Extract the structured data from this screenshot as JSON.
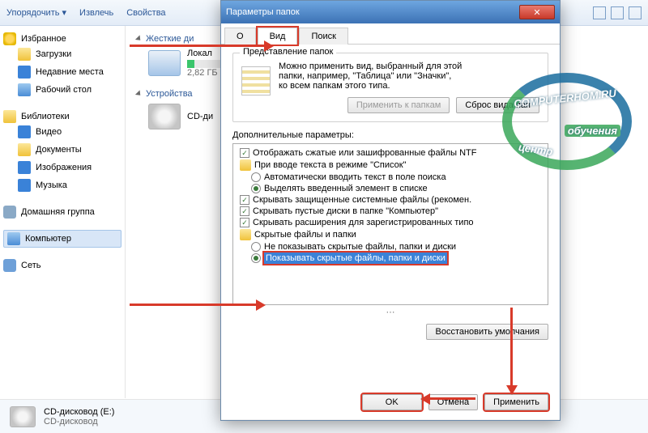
{
  "toolbar": {
    "organize": "Упорядочить ▾",
    "extract": "Извлечь",
    "props": "Свойства"
  },
  "sidebar": {
    "fav": "Избранное",
    "fav_items": [
      "Загрузки",
      "Недавние места",
      "Рабочий стол"
    ],
    "lib": "Библиотеки",
    "lib_items": [
      "Видео",
      "Документы",
      "Изображения",
      "Музыка"
    ],
    "hg": "Домашняя группа",
    "comp": "Компьютер",
    "net": "Сеть"
  },
  "content": {
    "hdd_section": "Жесткие ди",
    "local_disk": "Локал",
    "local_size": "2,82 ГБ",
    "dev_section": "Устройства",
    "cd_label": "CD-ди"
  },
  "footer": {
    "cd_title": "CD-дисковод (E:)",
    "cd_sub": "CD-дисковод"
  },
  "dialog": {
    "title": "Параметры папок",
    "tabs": {
      "general": "О",
      "view": "Вид",
      "search": "Поиск"
    },
    "group_title": "Представление папок",
    "group_text1": "Можно применить вид, выбранный для этой",
    "group_text2": "папки, например, \"Таблица\" или \"Значки\",",
    "group_text3": "ко всем папкам этого типа.",
    "apply_folders": "Применить к папкам",
    "reset_folders": "Сброс вида пап",
    "adv_label": "Дополнительные параметры:",
    "items": [
      {
        "t": "cb",
        "on": true,
        "txt": "Отображать сжатые или зашифрованные файлы NTF",
        "ind": 0
      },
      {
        "t": "f",
        "txt": "При вводе текста в режиме \"Список\"",
        "ind": 0
      },
      {
        "t": "rd",
        "on": false,
        "txt": "Автоматически вводить текст в поле поиска",
        "ind": 1
      },
      {
        "t": "rd",
        "on": true,
        "txt": "Выделять введенный элемент в списке",
        "ind": 1
      },
      {
        "t": "cb",
        "on": true,
        "txt": "Скрывать защищенные системные файлы (рекомен.",
        "ind": 0
      },
      {
        "t": "cb",
        "on": true,
        "txt": "Скрывать пустые диски в папке \"Компьютер\"",
        "ind": 0
      },
      {
        "t": "cb",
        "on": true,
        "txt": "Скрывать расширения для зарегистрированных типо",
        "ind": 0
      },
      {
        "t": "f",
        "txt": "Скрытые файлы и папки",
        "ind": 0
      },
      {
        "t": "rd",
        "on": false,
        "txt": "Не показывать скрытые файлы, папки и диски",
        "ind": 1
      },
      {
        "t": "rd",
        "on": true,
        "hl": true,
        "txt": "Показывать скрытые файлы, папки и диски",
        "ind": 1
      }
    ],
    "restore": "Восстановить умолчания",
    "ok": "OK",
    "cancel": "Отмена",
    "apply": "Применить"
  },
  "watermark": {
    "top": "COMPUTERHOM.RU",
    "bottom": "обучения",
    "left": "центр"
  }
}
